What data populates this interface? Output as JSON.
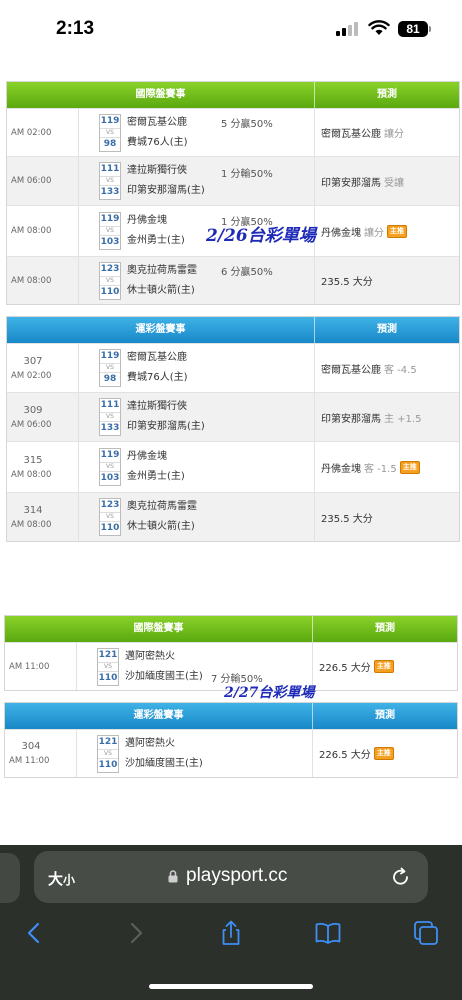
{
  "status": {
    "time": "2:13",
    "battery": "81"
  },
  "tables": [
    {
      "id": "intl-1",
      "header": {
        "main": "國際盤賽事",
        "pred": "預測"
      },
      "rows": [
        {
          "time": "AM 02:00",
          "num1": "119",
          "num2": "98",
          "team1": "密爾瓦基公鹿",
          "team2": "費城76人(主)",
          "result": "5 分贏50%",
          "pred": "密爾瓦基公鹿",
          "pred_sub": "讓分",
          "badge": ""
        },
        {
          "time": "AM 06:00",
          "num1": "111",
          "num2": "133",
          "team1": "達拉斯獨行俠",
          "team2": "印第安那溜馬(主)",
          "result": "1 分輸50%",
          "pred": "印第安那溜馬",
          "pred_sub": "受讓",
          "badge": ""
        },
        {
          "time": "AM 08:00",
          "num1": "119",
          "num2": "103",
          "team1": "丹佛金塊",
          "team2": "金州勇士(主)",
          "result": "1 分贏50%",
          "pred": "丹佛金塊",
          "pred_sub": "讓分",
          "badge": "主推"
        },
        {
          "time": "AM 08:00",
          "num1": "123",
          "num2": "110",
          "team1": "奧克拉荷馬雷霆",
          "team2": "休士頓火箭(主)",
          "result": "6 分贏50%",
          "pred": "235.5 大分",
          "pred_sub": "",
          "badge": ""
        }
      ]
    },
    {
      "id": "sports-1",
      "header": {
        "main": "運彩盤賽事",
        "pred": "預測"
      },
      "rows": [
        {
          "code": "307",
          "time": "AM 02:00",
          "num1": "119",
          "num2": "98",
          "team1": "密爾瓦基公鹿",
          "team2": "費城76人(主)",
          "pred": "密爾瓦基公鹿",
          "pred_sub": "客 -4.5",
          "badge": ""
        },
        {
          "code": "309",
          "time": "AM 06:00",
          "num1": "111",
          "num2": "133",
          "team1": "達拉斯獨行俠",
          "team2": "印第安那溜馬(主)",
          "pred": "印第安那溜馬",
          "pred_sub": "主 +1.5",
          "badge": ""
        },
        {
          "code": "315",
          "time": "AM 08:00",
          "num1": "119",
          "num2": "103",
          "team1": "丹佛金塊",
          "team2": "金州勇士(主)",
          "pred": "丹佛金塊",
          "pred_sub": "客 -1.5",
          "badge": "主推"
        },
        {
          "code": "314",
          "time": "AM 08:00",
          "num1": "123",
          "num2": "110",
          "team1": "奧克拉荷馬雷霆",
          "team2": "休士頓火箭(主)",
          "pred": "235.5 大分",
          "pred_sub": "",
          "badge": ""
        }
      ]
    },
    {
      "id": "intl-2",
      "header": {
        "main": "國際盤賽事",
        "pred": "預測"
      },
      "rows": [
        {
          "time": "AM 11:00",
          "num1": "121",
          "num2": "110",
          "team1": "邁阿密熱火",
          "team2": "沙加緬度國王(主)",
          "result": "7 分輸50%",
          "pred": "226.5 大分",
          "pred_sub": "",
          "badge": "主推"
        }
      ]
    },
    {
      "id": "sports-2",
      "header": {
        "main": "運彩盤賽事",
        "pred": "預測"
      },
      "rows": [
        {
          "code": "304",
          "time": "AM 11:00",
          "num1": "121",
          "num2": "110",
          "team1": "邁阿密熱火",
          "team2": "沙加緬度國王(主)",
          "pred": "226.5 大分",
          "pred_sub": "",
          "badge": "主推"
        }
      ]
    }
  ],
  "overlays": {
    "first": "2/26台彩單場",
    "second": "2/27台彩單場"
  },
  "browser": {
    "text_size_label": "大",
    "text_size_small": "小",
    "url": "playsport.cc"
  },
  "colors": {
    "green_header": "#6cbc1c",
    "blue_header": "#249ad6",
    "badge": "#f5a020",
    "overlay_text": "#1e2bb8"
  }
}
